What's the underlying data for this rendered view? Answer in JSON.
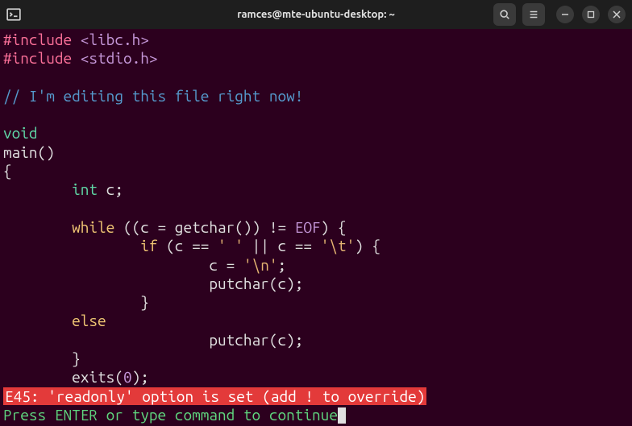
{
  "titlebar": {
    "title": "ramces@mte-ubuntu-desktop: ~"
  },
  "code": {
    "lines": [
      {
        "preproc": "#include ",
        "header": "<libc.h>"
      },
      {
        "preproc": "#include ",
        "header": "<stdio.h>"
      },
      {
        "blank": true
      },
      {
        "comment": "// I'm editing this file right now!"
      },
      {
        "blank": true
      },
      {
        "type": "void"
      },
      {
        "plain": "main()"
      },
      {
        "plain": "{"
      },
      {
        "indent": "        ",
        "type": "int",
        "plain": " c;"
      },
      {
        "blank": true
      },
      {
        "indent": "        ",
        "keyword": "while",
        "plain1": " ((c = getchar()) != ",
        "const": "EOF",
        "plain2": ") {"
      },
      {
        "indent": "                ",
        "keyword": "if",
        "plain1": " (c == ",
        "string1": "' '",
        "plain2": " || c == ",
        "string2": "'\\t'",
        "plain3": ") {"
      },
      {
        "indent": "                        ",
        "plain1": "c = ",
        "string1": "'\\n'",
        "plain2": ";"
      },
      {
        "indent": "                        ",
        "plain": "putchar(c);"
      },
      {
        "indent": "                ",
        "plain": "}"
      },
      {
        "indent": "        ",
        "keyword": "else"
      },
      {
        "indent": "                        ",
        "plain": "putchar(c);"
      },
      {
        "indent": "        ",
        "plain": "}"
      },
      {
        "indent": "        ",
        "plain1": "exits(",
        "number": "0",
        "plain2": ");"
      }
    ]
  },
  "status": {
    "error": "E45: 'readonly' option is set (add ! to override)",
    "prompt": "Press ENTER or type command to continue"
  }
}
